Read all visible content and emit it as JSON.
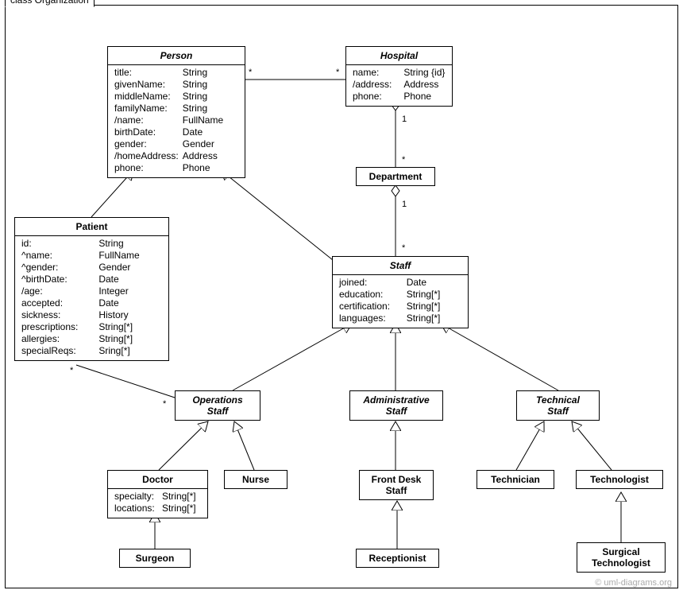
{
  "frame": {
    "label": "class Organization"
  },
  "watermark": "© uml-diagrams.org",
  "classes": {
    "person": {
      "name": "Person",
      "attrs": [
        [
          "title:",
          "String"
        ],
        [
          "givenName:",
          "String"
        ],
        [
          "middleName:",
          "String"
        ],
        [
          "familyName:",
          "String"
        ],
        [
          "/name:",
          "FullName"
        ],
        [
          "birthDate:",
          "Date"
        ],
        [
          "gender:",
          "Gender"
        ],
        [
          "/homeAddress:",
          "Address"
        ],
        [
          "phone:",
          "Phone"
        ]
      ]
    },
    "hospital": {
      "name": "Hospital",
      "attrs": [
        [
          "name:",
          "String {id}"
        ],
        [
          "/address:",
          "Address"
        ],
        [
          "phone:",
          "Phone"
        ]
      ]
    },
    "department": {
      "name": "Department"
    },
    "patient": {
      "name": "Patient",
      "attrs": [
        [
          "id:",
          "String"
        ],
        [
          "^name:",
          "FullName"
        ],
        [
          "^gender:",
          "Gender"
        ],
        [
          "^birthDate:",
          "Date"
        ],
        [
          "/age:",
          "Integer"
        ],
        [
          "accepted:",
          "Date"
        ],
        [
          "sickness:",
          "History"
        ],
        [
          "prescriptions:",
          "String[*]"
        ],
        [
          "allergies:",
          "String[*]"
        ],
        [
          "specialReqs:",
          "Sring[*]"
        ]
      ]
    },
    "staff": {
      "name": "Staff",
      "attrs": [
        [
          "joined:",
          "Date"
        ],
        [
          "education:",
          "String[*]"
        ],
        [
          "certification:",
          "String[*]"
        ],
        [
          "languages:",
          "String[*]"
        ]
      ]
    },
    "operationsStaff": {
      "name_l1": "Operations",
      "name_l2": "Staff"
    },
    "administrativeStaff": {
      "name_l1": "Administrative",
      "name_l2": "Staff"
    },
    "technicalStaff": {
      "name_l1": "Technical",
      "name_l2": "Staff"
    },
    "doctor": {
      "name": "Doctor",
      "attrs": [
        [
          "specialty:",
          "String[*]"
        ],
        [
          "locations:",
          "String[*]"
        ]
      ]
    },
    "nurse": {
      "name": "Nurse"
    },
    "frontDeskStaff": {
      "name_l1": "Front Desk",
      "name_l2": "Staff"
    },
    "technician": {
      "name": "Technician"
    },
    "technologist": {
      "name": "Technologist"
    },
    "surgeon": {
      "name": "Surgeon"
    },
    "receptionist": {
      "name": "Receptionist"
    },
    "surgicalTechnologist": {
      "name_l1": "Surgical",
      "name_l2": "Technologist"
    }
  },
  "multiplicities": {
    "person_hospital_p": "*",
    "person_hospital_h": "*",
    "hospital_dept_h": "1",
    "hospital_dept_d": "*",
    "dept_staff_d": "1",
    "dept_staff_s": "*",
    "ops_patient_o": "*",
    "ops_patient_p": "*"
  }
}
